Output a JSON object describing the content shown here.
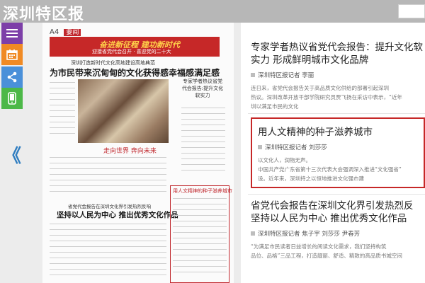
{
  "header": {
    "logo_text": "深圳特区报"
  },
  "toolbar": {
    "items": [
      {
        "icon": "menu-icon",
        "color": "#7d3fa8"
      },
      {
        "icon": "calendar-icon",
        "color": "#f08a24"
      },
      {
        "icon": "share-icon",
        "color": "#4a90d9"
      },
      {
        "icon": "mobile-icon",
        "color": "#4cb848"
      }
    ],
    "collapse_glyph": "《"
  },
  "paper": {
    "page_label": "A4",
    "section_label": "要闻",
    "banner_text": "奋进新征程 建功新时代",
    "banner_sub": "迎接省党代会召开 · 喜迎党的二十大",
    "headline": "为市民带来沉甸甸的文化获得感幸福感满足感",
    "kicker": "深圳打造新时代文化高地建设高地典范",
    "photo_caption": "走向世界 奔向未来",
    "side_title": "专家学者热议省党代会报告:提升文化软实力",
    "boxed_title": "用人文精神的种子滋养城市",
    "headline2": "坚持以人民为中心 推出优秀文化作品",
    "kicker2": "省党代会报告在深圳文化界引发热烈反响"
  },
  "articles": [
    {
      "title_line1": "专家学者热议省党代会报告：提升文化软",
      "title_line2": "实力 形成鲜明城市文化品牌",
      "meta": "深圳特区报记者 李丽",
      "snippet_line1": "连日来，省党代会报告关于高品质文化供给的部署引起深圳",
      "snippet_line2": "热议。深圳改革开放干部学院研究员贾飞扬在采访中表示，“近年",
      "snippet_line3": "圳以满足市民的文化"
    },
    {
      "title_line1": "用人文精神的种子滋养城市",
      "meta": "深圳特区报记者 刘莎莎",
      "snippet_line1": "以文化人，润物无声。",
      "snippet_line2": "中国共产党广东省第十三次代表大会强调深入推进“文化强省”",
      "snippet_line3": "设。近年来，深圳持之以恒地推进文化强市建"
    },
    {
      "title_line1": "省党代会报告在深圳文化界引发热烈反",
      "title_line2": "坚持以人民为中心 推出优秀文化作品",
      "meta": "深圳特区报记者 焦子宇 刘莎莎 尹春芳",
      "snippet_line1": "“为满足市民读者日益增长的阅读文化需求，我们坚持构筑",
      "snippet_line2": "品位、品格”三品工程，打造靓丽、舒适、精致的高品质书城空间"
    }
  ],
  "colors": {
    "highlight_border": "#c62828",
    "header_bg": "#b7b7b7"
  }
}
